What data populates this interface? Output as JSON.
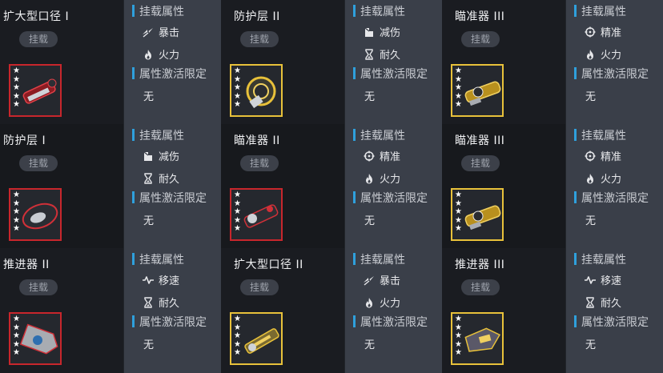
{
  "labels": {
    "mount_button": "挂载",
    "mount_attr_title": "挂载属性",
    "activation_title": "属性激活限定",
    "none": "无"
  },
  "cells": [
    {
      "name": "扩大型口径 I",
      "frame": "red",
      "stars": 5,
      "art": "barrel-red",
      "attrs": [
        {
          "icon": "crit-icon",
          "label": "暴击"
        },
        {
          "icon": "fire-icon",
          "label": "火力"
        }
      ]
    },
    {
      "name": "防护层 II",
      "frame": "gold",
      "stars": 5,
      "art": "shield-gold",
      "attrs": [
        {
          "icon": "damage-reduction-icon",
          "label": "减伤"
        },
        {
          "icon": "hourglass-icon",
          "label": "耐久"
        }
      ]
    },
    {
      "name": "瞄准器 III",
      "frame": "gold",
      "stars": 5,
      "art": "scope-gold",
      "attrs": [
        {
          "icon": "crosshair-icon",
          "label": "精准"
        },
        {
          "icon": "fire-icon",
          "label": "火力"
        }
      ]
    },
    {
      "name": "防护层 I",
      "frame": "red",
      "stars": 5,
      "art": "shield-red",
      "attrs": [
        {
          "icon": "damage-reduction-icon",
          "label": "减伤"
        },
        {
          "icon": "hourglass-icon",
          "label": "耐久"
        }
      ]
    },
    {
      "name": "瞄准器 II",
      "frame": "red",
      "stars": 5,
      "art": "scope-red",
      "attrs": [
        {
          "icon": "crosshair-icon",
          "label": "精准"
        },
        {
          "icon": "fire-icon",
          "label": "火力"
        }
      ]
    },
    {
      "name": "瞄准器 III",
      "frame": "gold",
      "stars": 5,
      "art": "scope-gold",
      "attrs": [
        {
          "icon": "crosshair-icon",
          "label": "精准"
        },
        {
          "icon": "fire-icon",
          "label": "火力"
        }
      ]
    },
    {
      "name": "推进器 II",
      "frame": "red",
      "stars": 5,
      "art": "thruster-red",
      "attrs": [
        {
          "icon": "speed-icon",
          "label": "移速"
        },
        {
          "icon": "hourglass-icon",
          "label": "耐久"
        }
      ]
    },
    {
      "name": "扩大型口径 II",
      "frame": "gold",
      "stars": 5,
      "art": "barrel-gold",
      "attrs": [
        {
          "icon": "crit-icon",
          "label": "暴击"
        },
        {
          "icon": "fire-icon",
          "label": "火力"
        }
      ]
    },
    {
      "name": "推进器 III",
      "frame": "gold",
      "stars": 5,
      "art": "thruster-gold",
      "attrs": [
        {
          "icon": "speed-icon",
          "label": "移速"
        },
        {
          "icon": "hourglass-icon",
          "label": "耐久"
        }
      ]
    }
  ]
}
